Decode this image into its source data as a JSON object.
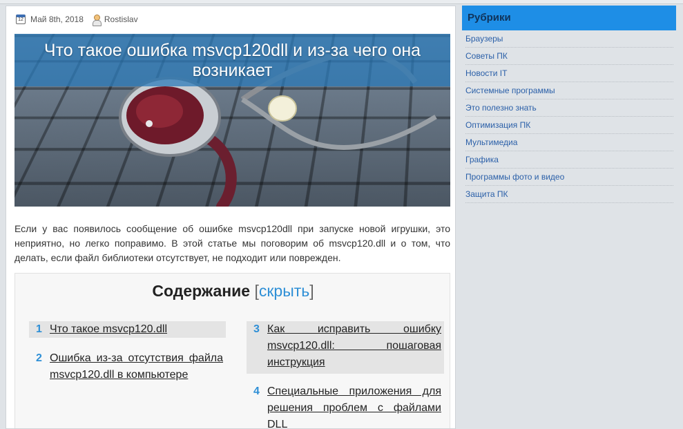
{
  "meta": {
    "date": "Май 8th, 2018",
    "author": "Rostislav",
    "calendar_icon_text": "12"
  },
  "article": {
    "title": "Что такое ошибка msvcp120dll и из-за чего она возникает",
    "intro": "Если у вас появилось сообщение об ошибке msvcp120dll при запуске новой игрушки, это неприятно, но легко поправимо. В этой статье мы поговорим об msvcp120.dll и о том, что делать, если файл библиотеки отсутствует, не подходит или поврежден."
  },
  "toc": {
    "heading": "Содержание",
    "bracket_open": "[",
    "hide_label": "скрыть",
    "bracket_close": "]",
    "items": [
      {
        "num": "1",
        "text": "Что такое msvcp120.dll"
      },
      {
        "num": "2",
        "text": "Ошибка из-за отсутствия файла msvcp120.dll в компьютере"
      },
      {
        "num": "3",
        "text": "Как исправить ошибку msvcp120.dll: пошаговая инструкция"
      },
      {
        "num": "4",
        "text": "Специальные приложения для решения проблем с файлами DLL"
      }
    ]
  },
  "sidebar": {
    "title": "Рубрики",
    "items": [
      "Браузеры",
      "Советы ПК",
      "Новости IT",
      "Системные программы",
      "Это полезно знать",
      "Оптимизация ПК",
      "Мультимедиа",
      "Графика",
      "Программы фото и видео",
      "Защита ПК"
    ]
  },
  "colors": {
    "accent": "#1e8ee6",
    "link": "#2a5fa8",
    "toc_number": "#2e8fd6"
  }
}
